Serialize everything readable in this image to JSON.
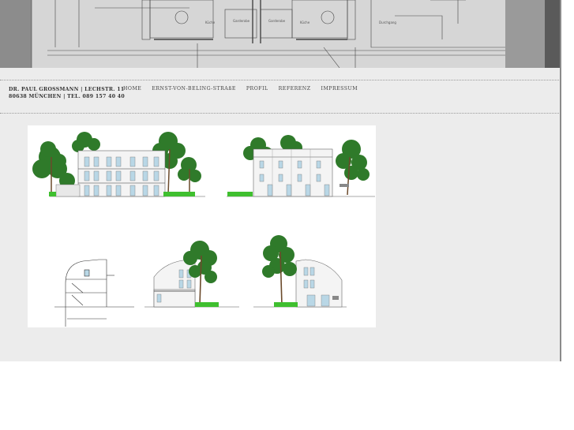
{
  "company": {
    "line1": "DR. PAUL GROSSMANN | LECHSTR. 11",
    "line2": "80638 MÜNCHEN | TEL. 089 157 40 40"
  },
  "nav": [
    {
      "label": "HOME"
    },
    {
      "label": "ERNST-VON-BELING-STRAßE"
    },
    {
      "label": "PROFIL"
    },
    {
      "label": "REFERENZ"
    },
    {
      "label": "IMPRESSUM"
    }
  ],
  "colors": {
    "page_bg": "#ececec",
    "tree_green": "#2f7a2a",
    "hedge_green": "#3fbf2f",
    "window_blue": "#b9d7e6"
  }
}
